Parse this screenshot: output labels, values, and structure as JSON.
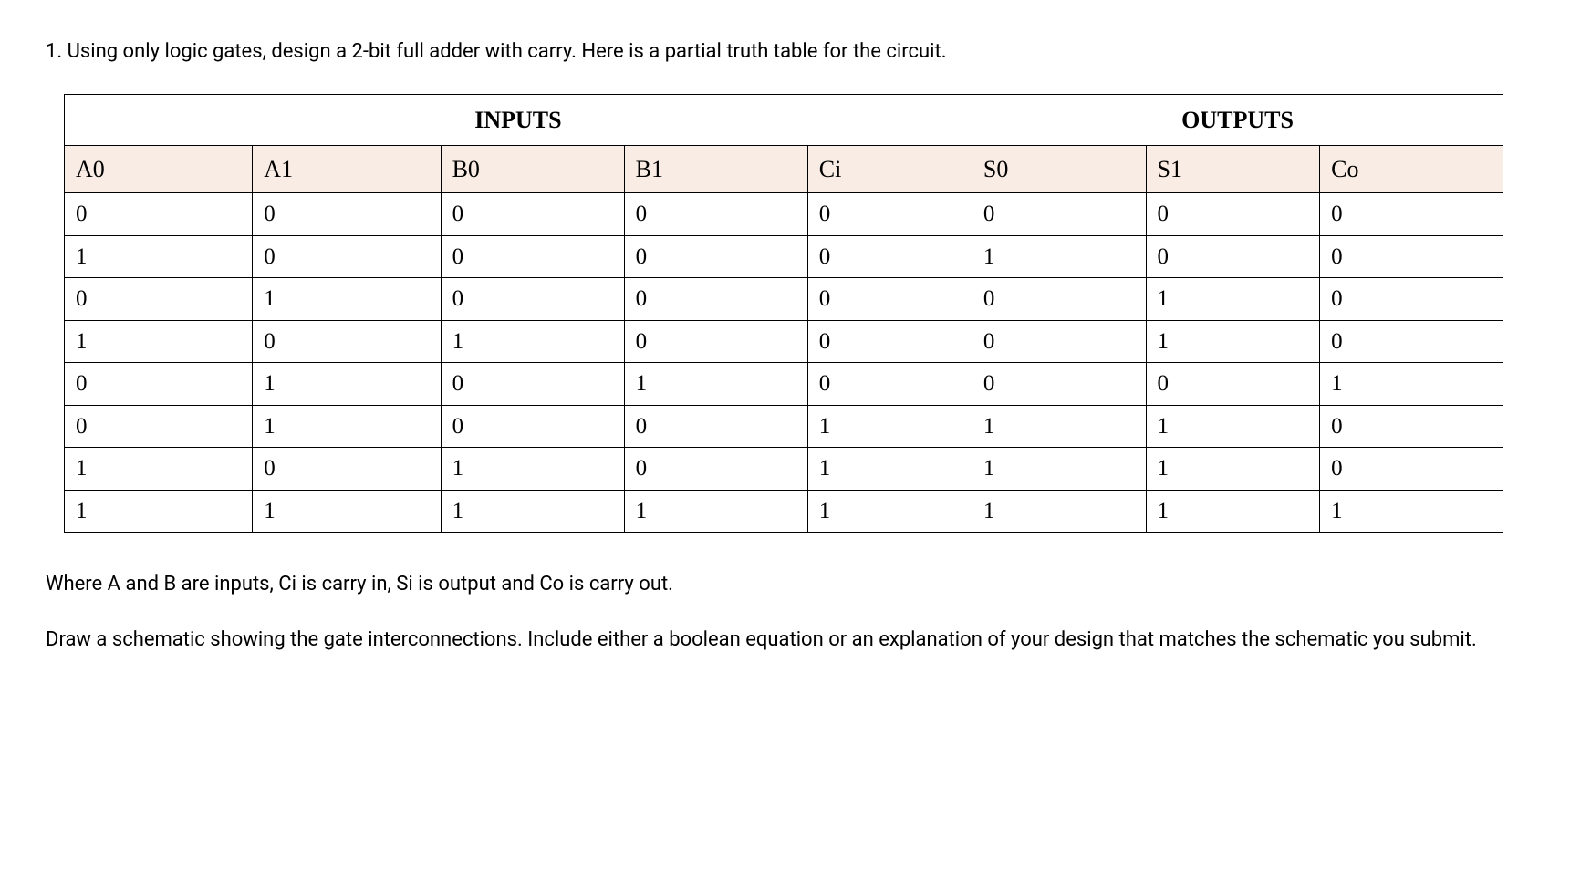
{
  "question": "1. Using only logic gates, design a 2-bit full adder with carry. Here is a partial truth table for the circuit.",
  "table": {
    "group_headers": {
      "inputs": "INPUTS",
      "outputs": "OUTPUTS"
    },
    "headers": [
      "A0",
      "A1",
      "B0",
      "B1",
      "Ci",
      "S0",
      "S1",
      "Co"
    ],
    "rows": [
      [
        "0",
        "0",
        "0",
        "0",
        "0",
        "0",
        "0",
        "0"
      ],
      [
        "1",
        "0",
        "0",
        "0",
        "0",
        "1",
        "0",
        "0"
      ],
      [
        "0",
        "1",
        "0",
        "0",
        "0",
        "0",
        "1",
        "0"
      ],
      [
        "1",
        "0",
        "1",
        "0",
        "0",
        "0",
        "1",
        "0"
      ],
      [
        "0",
        "1",
        "0",
        "1",
        "0",
        "0",
        "0",
        "1"
      ],
      [
        "0",
        "1",
        "0",
        "0",
        "1",
        "1",
        "1",
        "0"
      ],
      [
        "1",
        "0",
        "1",
        "0",
        "1",
        "1",
        "1",
        "0"
      ],
      [
        "1",
        "1",
        "1",
        "1",
        "1",
        "1",
        "1",
        "1"
      ]
    ]
  },
  "description": "Where A and B are inputs, Ci is carry in, Si is output and Co is carry out.",
  "instruction": "Draw a schematic showing the gate interconnections. Include either a boolean equation or an explanation of your design that matches the schematic you submit."
}
